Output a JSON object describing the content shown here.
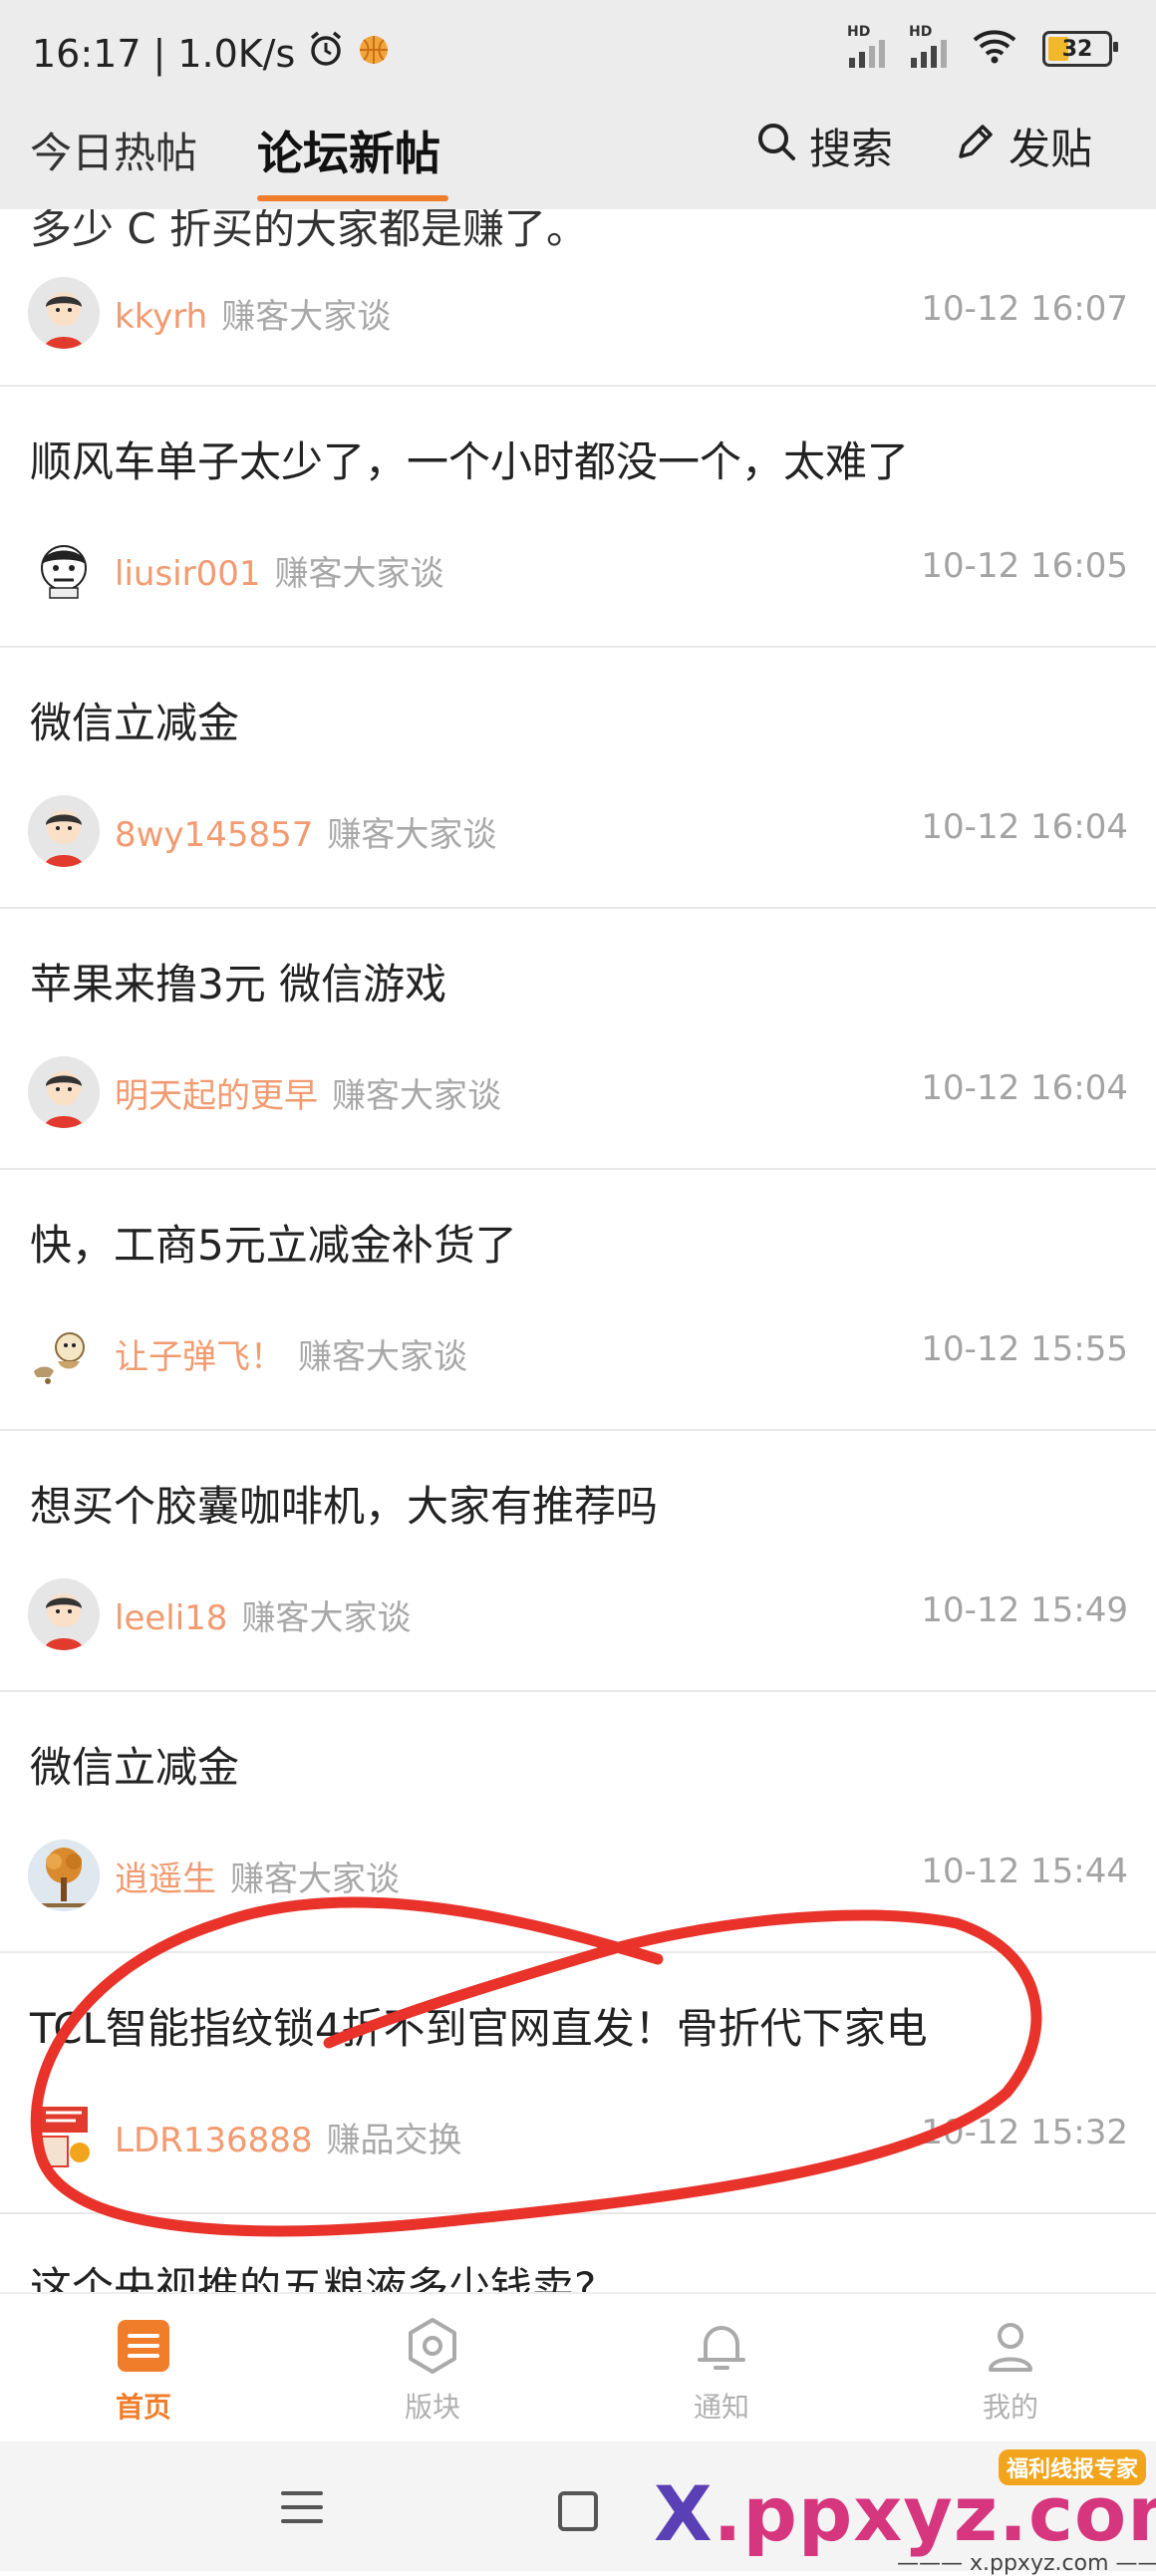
{
  "status": {
    "time": "16:17",
    "speed": "1.0K/s",
    "hd1": "HD",
    "hd2": "HD",
    "battery": "32"
  },
  "nav": {
    "tab_today": "今日热帖",
    "tab_forum": "论坛新帖",
    "search_label": "搜索",
    "post_label": "发贴"
  },
  "cut_title": "多少 C 折买的大家都是赚了。",
  "first_meta": {
    "author": "kkyrh",
    "board": "赚客大家谈",
    "time": "10-12 16:07"
  },
  "posts": [
    {
      "title": "顺风车单子太少了，一个小时都没一个，太难了",
      "author": "liusir001",
      "board": "赚客大家谈",
      "time": "10-12 16:05"
    },
    {
      "title": "微信立减金",
      "author": "8wy145857",
      "board": "赚客大家谈",
      "time": "10-12 16:04"
    },
    {
      "title": "苹果来撸3元 微信游戏",
      "author": "明天起的更早",
      "board": "赚客大家谈",
      "time": "10-12 16:04"
    },
    {
      "title": "快，工商5元立减金补货了",
      "author": "让子弹飞！",
      "board": "赚客大家谈",
      "time": "10-12 15:55"
    },
    {
      "title": "想买个胶囊咖啡机，大家有推荐吗",
      "author": "leeli18",
      "board": "赚客大家谈",
      "time": "10-12 15:49"
    },
    {
      "title": "微信立减金",
      "author": "逍遥生",
      "board": "赚客大家谈",
      "time": "10-12 15:44"
    },
    {
      "title": "TCL智能指纹锁4折不到官网直发！骨折代下家电",
      "author": "LDR136888",
      "board": "赚品交换",
      "time": "10-12 15:32"
    },
    {
      "title": "这个央视推的五粮液多少钱卖?"
    }
  ],
  "bottom_nav": [
    "首页",
    "版块",
    "通知",
    "我的"
  ],
  "watermark": {
    "x": "X",
    "rest": ".ppxyz.com",
    "tag": "福利线报专家",
    "sub": "——— x.ppxyz.com ———"
  },
  "colors": {
    "accent": "#f07d2a",
    "author": "#f29a70",
    "annotation": "#e8322a"
  }
}
